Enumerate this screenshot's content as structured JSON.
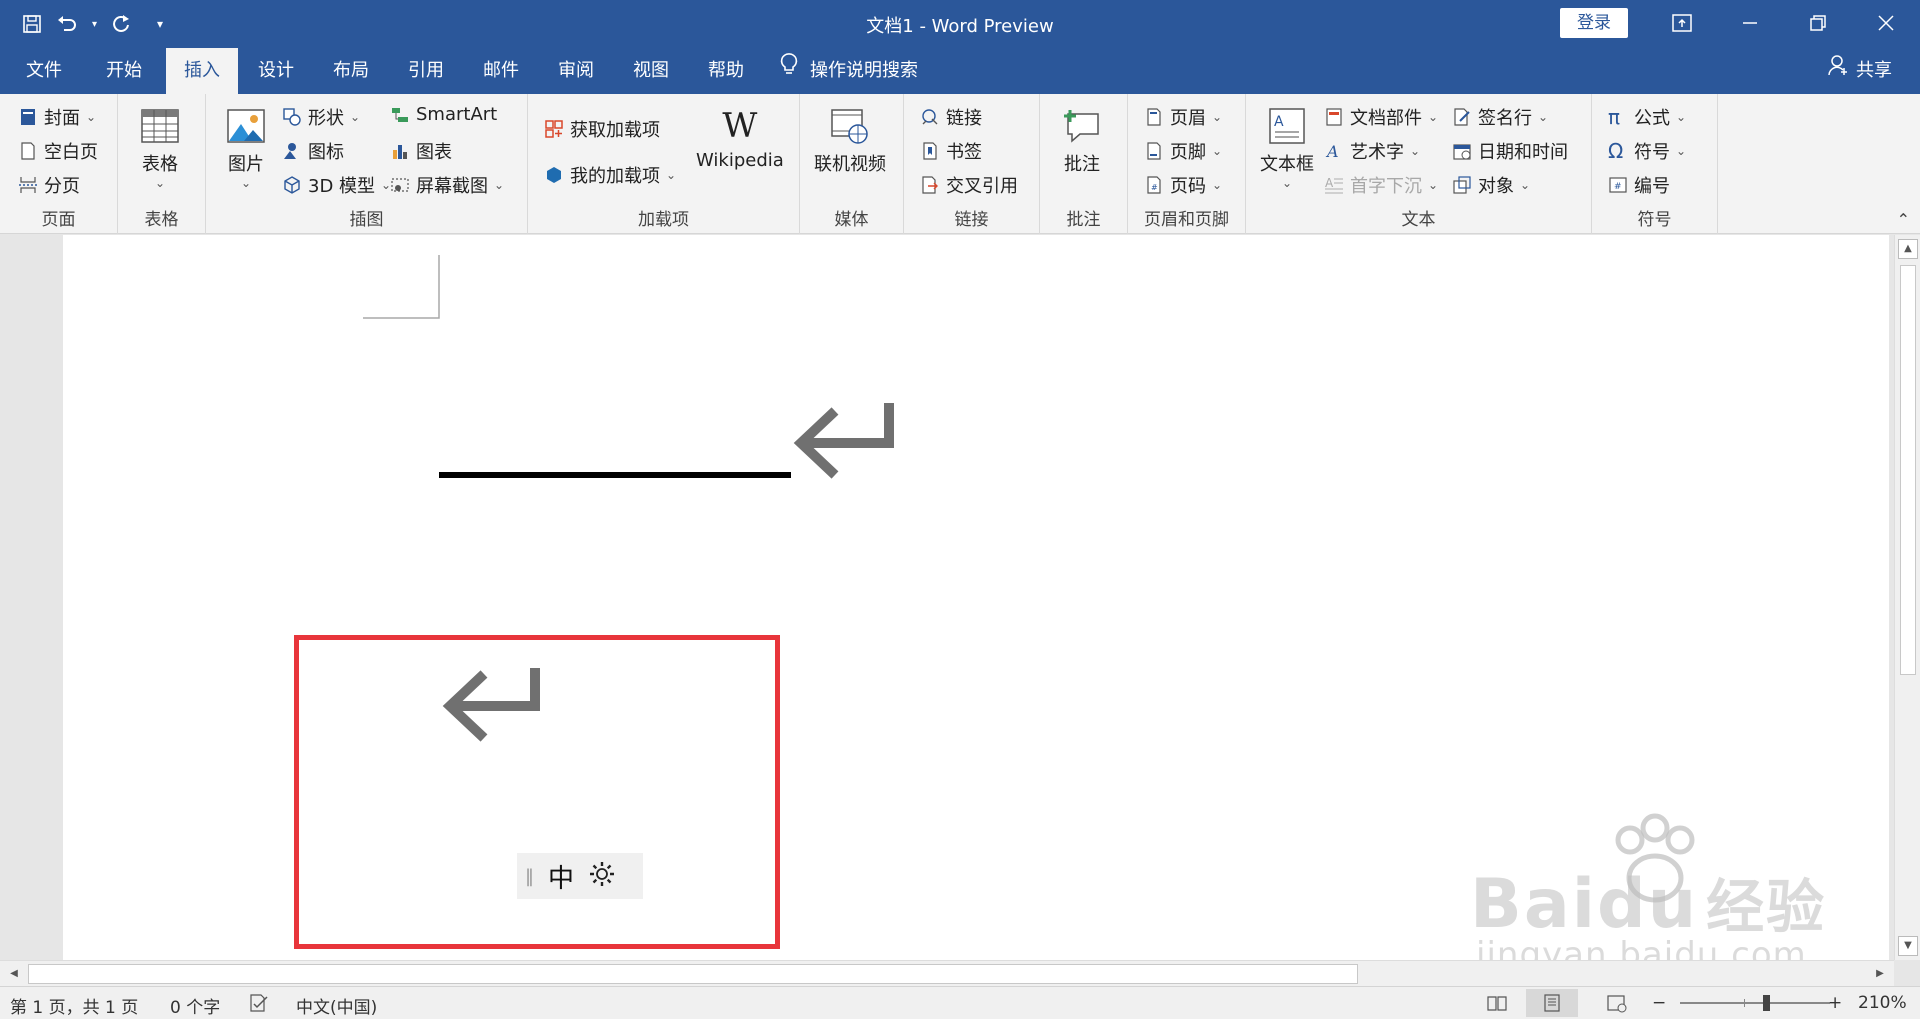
{
  "window": {
    "title": "文档1  -  Word Preview",
    "login_label": "登录"
  },
  "tabs": [
    {
      "label": "文件"
    },
    {
      "label": "开始"
    },
    {
      "label": "插入",
      "active": true
    },
    {
      "label": "设计"
    },
    {
      "label": "布局"
    },
    {
      "label": "引用"
    },
    {
      "label": "邮件"
    },
    {
      "label": "审阅"
    },
    {
      "label": "视图"
    },
    {
      "label": "帮助"
    }
  ],
  "tellme_label": "操作说明搜索",
  "share_label": "共享",
  "ribbon": {
    "pages": {
      "label": "页面",
      "items": [
        "封面",
        "空白页",
        "分页"
      ]
    },
    "tables": {
      "label": "表格",
      "table_button": "表格"
    },
    "illustrations": {
      "label": "插图",
      "picture": "图片",
      "items": [
        "形状",
        "图标",
        "3D 模型",
        "SmartArt",
        "图表",
        "屏幕截图"
      ]
    },
    "addins": {
      "label": "加载项",
      "get": "获取加载项",
      "mine": "我的加载项",
      "wikipedia": "Wikipedia"
    },
    "media": {
      "label": "媒体",
      "video": "联机视频"
    },
    "links": {
      "label": "链接",
      "items": [
        "链接",
        "书签",
        "交叉引用"
      ]
    },
    "comments": {
      "label": "批注",
      "comment": "批注"
    },
    "header_footer": {
      "label": "页眉和页脚",
      "items": [
        "页眉",
        "页脚",
        "页码"
      ]
    },
    "text": {
      "label": "文本",
      "textbox": "文本框",
      "items": [
        "文档部件",
        "艺术字",
        "首字下沉",
        "签名行",
        "日期和时间",
        "对象"
      ]
    },
    "symbols": {
      "label": "符号",
      "items": [
        "公式",
        "符号",
        "编号"
      ]
    }
  },
  "ime": {
    "mode": "中"
  },
  "status": {
    "page": "第 1 页，共 1 页",
    "words": "0 个字",
    "language": "中文(中国)",
    "zoom": "210%"
  },
  "watermark": {
    "brand": "Bai",
    "brand2": "du",
    "cn": "经验",
    "url": "jingyan.baidu.com"
  },
  "colors": {
    "ribbon_blue": "#2b579a",
    "highlight_red": "#e8353b"
  }
}
